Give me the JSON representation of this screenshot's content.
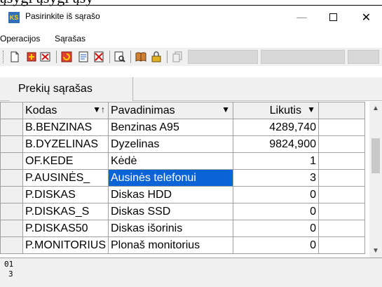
{
  "cropped_top_text": "ąšygi ąšygi ąšy",
  "window": {
    "title": "Pasirinkite iš sąrašo",
    "icon_label": "KS",
    "minimize": "—",
    "close": "✕"
  },
  "menu": [
    "Operacijos",
    "Sąrašas"
  ],
  "toolbar_icons": [
    "new-document-icon",
    "add-icon",
    "delete-icon",
    "refresh-icon",
    "edit-icon",
    "remove-icon",
    "search-icon",
    "book-icon",
    "lock-icon",
    "copy-icon"
  ],
  "tab": {
    "label": "Prekių sąrašas"
  },
  "table": {
    "columns": [
      "Kodas",
      "Pavadinimas",
      "Likutis"
    ],
    "sort_marks": [
      "▼↑",
      "▼",
      "▼"
    ],
    "rows": [
      [
        "B.BENZINAS",
        "Benzinas A95",
        "4289,740"
      ],
      [
        "B.DYZELINAS",
        "Dyzelinas",
        "9824,900"
      ],
      [
        "OF.KEDE",
        "Kėdė",
        "1"
      ],
      [
        "P.AUSINĖS_",
        "Ausinės telefonui",
        "3"
      ],
      [
        "P.DISKAS",
        "Diskas HDD",
        "0"
      ],
      [
        "P.DISKAS_S",
        "Diskas SSD",
        "0"
      ],
      [
        "P.DISKAS50",
        "Diskas išorinis",
        "0"
      ],
      [
        "P.MONITORIUS",
        "Plonaš monitorius",
        "0"
      ]
    ],
    "selected_row": 3
  },
  "status": {
    "line1": "01",
    "line2": "3"
  }
}
